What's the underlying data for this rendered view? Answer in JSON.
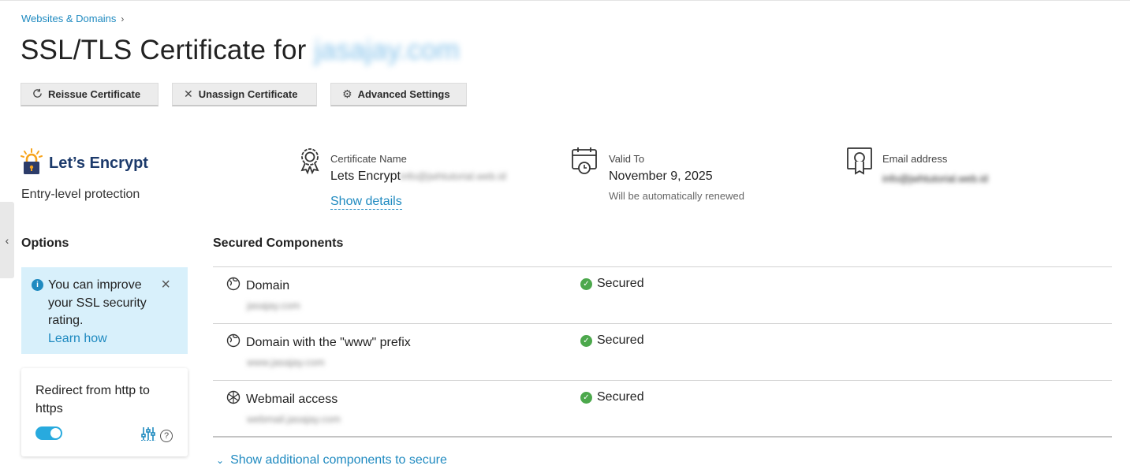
{
  "breadcrumb": {
    "item": "Websites & Domains"
  },
  "title": {
    "prefix": "SSL/TLS Certificate for",
    "domain": "jasajay.com"
  },
  "toolbar": {
    "reissue": "Reissue Certificate",
    "unassign": "Unassign Certificate",
    "advanced": "Advanced Settings"
  },
  "provider": {
    "name": "Let’s Encrypt",
    "tagline": "Entry-level protection"
  },
  "cert": {
    "name_label": "Certificate Name",
    "name_value": "Lets Encrypt",
    "name_hidden": "info@jwhtutorial.web.id",
    "show_details": "Show details",
    "valid_label": "Valid To",
    "valid_value": "November 9, 2025",
    "valid_note": "Will be automatically renewed",
    "email_label": "Email address",
    "email_value": "info@jwhtutorial.web.id"
  },
  "options": {
    "title": "Options",
    "notice_text": "You can improve your SSL security rating.",
    "notice_link": "Learn how",
    "redirect_label": "Redirect from http to https",
    "redirect_enabled": true
  },
  "secured": {
    "title": "Secured Components",
    "rows": [
      {
        "label": "Domain",
        "sub": "jasajay.com",
        "status": "Secured"
      },
      {
        "label": "Domain with the \"www\" prefix",
        "sub": "www.jasajay.com",
        "status": "Secured"
      },
      {
        "label": "Webmail access",
        "sub": "webmail.jasajay.com",
        "status": "Secured"
      }
    ],
    "more_link": "Show additional components to secure"
  }
}
